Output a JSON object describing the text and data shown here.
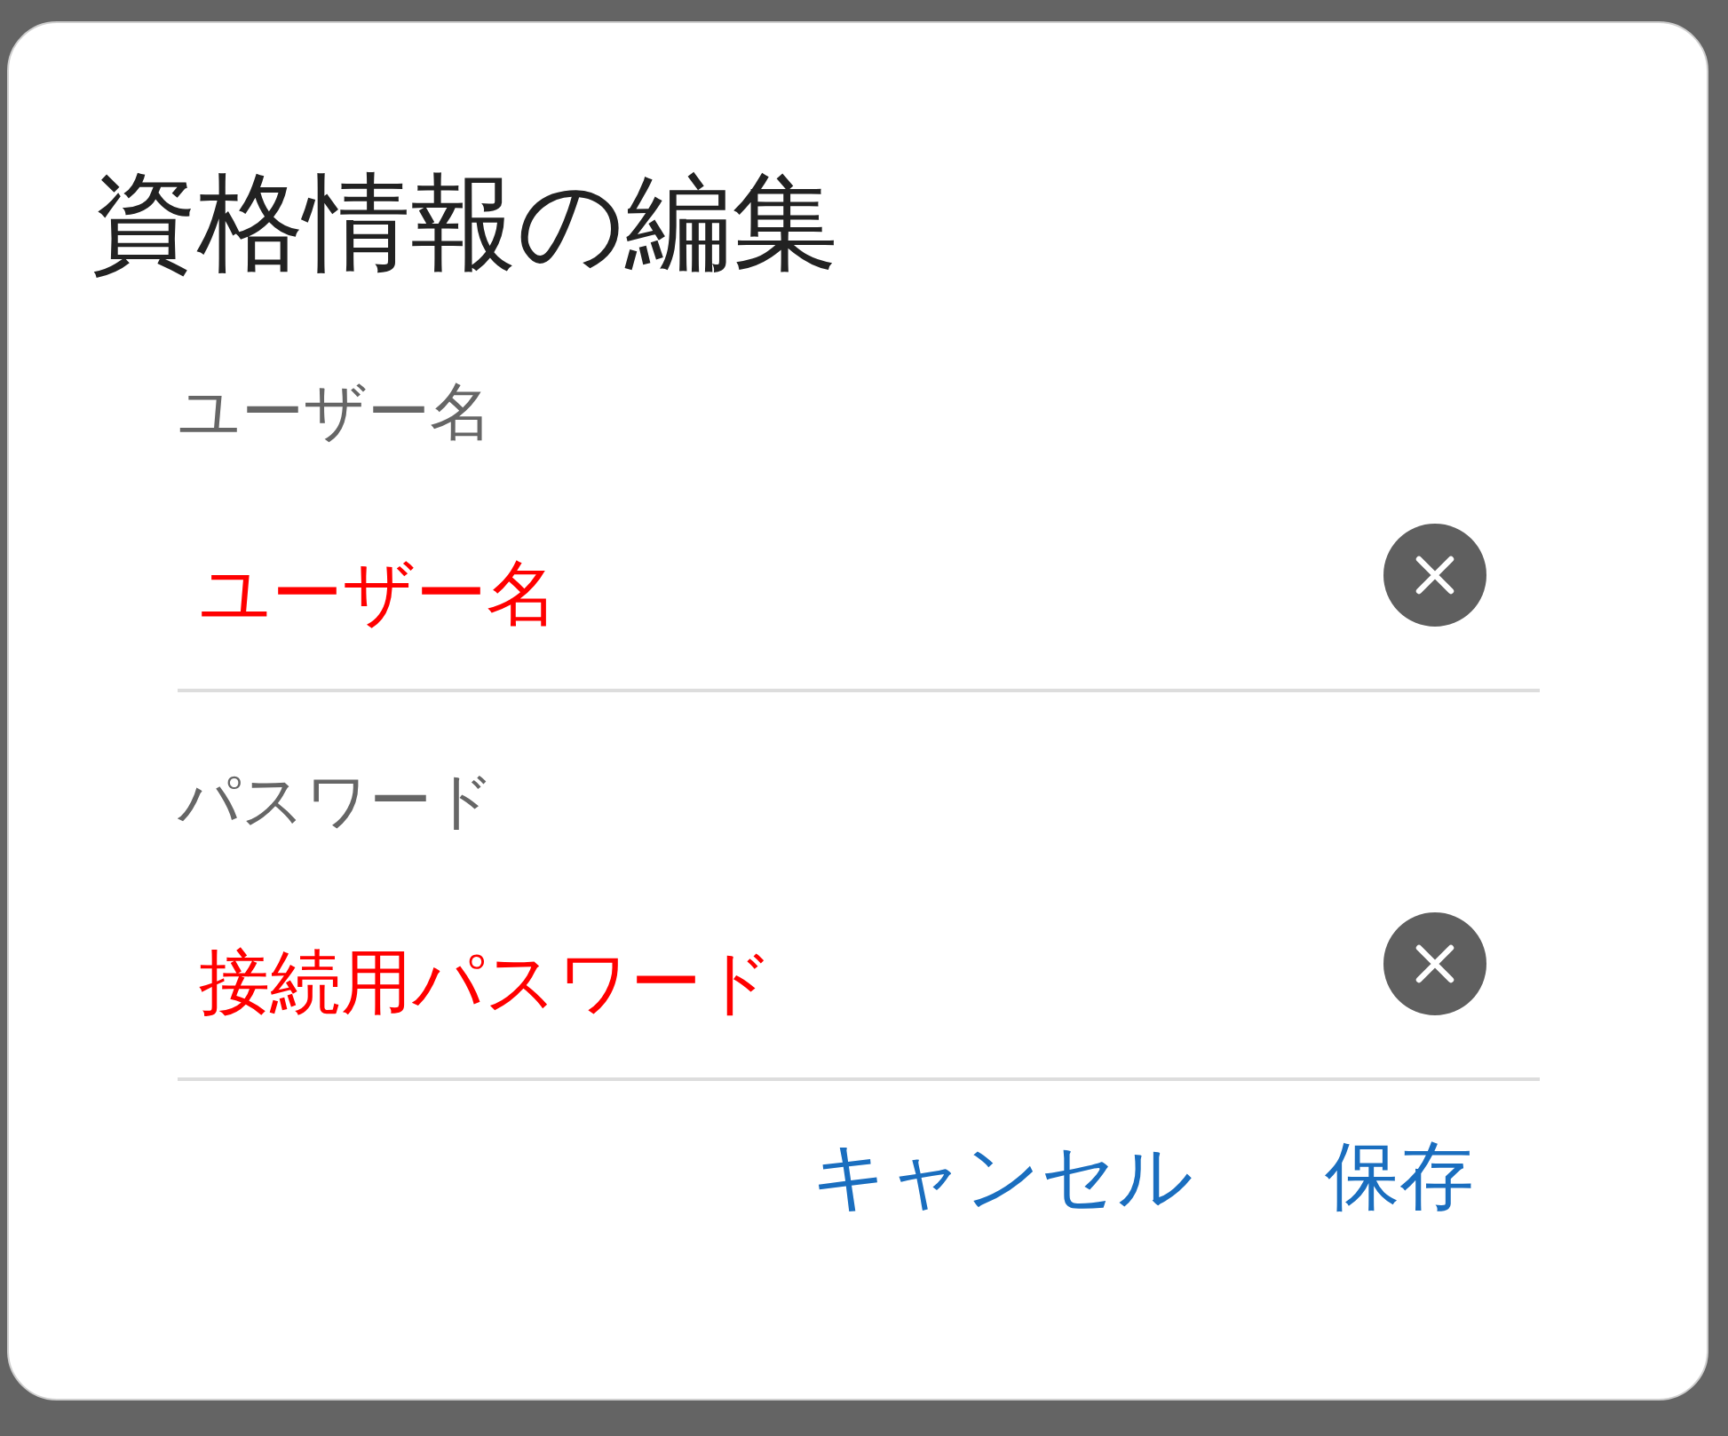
{
  "dialog": {
    "title": "資格情報の編集"
  },
  "fields": [
    {
      "label": "ユーザー名",
      "placeholder": "ユーザー名"
    },
    {
      "label": "パスワード",
      "placeholder": "接続用パスワード"
    }
  ],
  "buttons": [
    "キャンセル",
    "保存"
  ]
}
